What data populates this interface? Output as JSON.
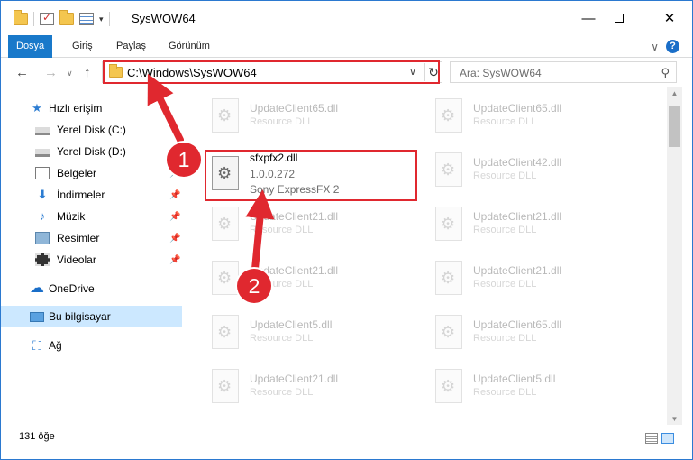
{
  "window": {
    "title": "SysWOW64",
    "controls": {
      "minimize": "—",
      "maximize": "",
      "close": "✕"
    }
  },
  "ribbon": {
    "tabs": [
      "Dosya",
      "Giriş",
      "Paylaş",
      "Görünüm"
    ],
    "help": "?",
    "chevron": "∨"
  },
  "nav": {
    "back": "←",
    "forward": "→",
    "recent": "∨",
    "up": "↑",
    "address": "C:\\Windows\\SysWOW64",
    "address_dropdown": "∨",
    "refresh": "↻",
    "search_placeholder": "Ara: SysWOW64",
    "search_icon": "⚲"
  },
  "sidebar": {
    "items": [
      {
        "label": "Hızlı erişim",
        "icon": "star-icon",
        "glyph": "★",
        "pinned": false
      },
      {
        "label": "Yerel Disk (C:)",
        "icon": "disk-icon",
        "glyph": "",
        "pinned": false
      },
      {
        "label": "Yerel Disk (D:)",
        "icon": "disk-icon",
        "glyph": "",
        "pinned": false
      },
      {
        "label": "Belgeler",
        "icon": "documents-icon",
        "glyph": "",
        "pinned": true
      },
      {
        "label": "İndirmeler",
        "icon": "downloads-icon",
        "glyph": "⬇",
        "pinned": true
      },
      {
        "label": "Müzik",
        "icon": "music-icon",
        "glyph": "♪",
        "pinned": true
      },
      {
        "label": "Resimler",
        "icon": "pictures-icon",
        "glyph": "",
        "pinned": true
      },
      {
        "label": "Videolar",
        "icon": "videos-icon",
        "glyph": "",
        "pinned": true
      },
      {
        "label": "OneDrive",
        "icon": "cloud-icon",
        "glyph": "☁",
        "pinned": false
      },
      {
        "label": "Bu bilgisayar",
        "icon": "computer-icon",
        "glyph": "",
        "pinned": false
      },
      {
        "label": "Ağ",
        "icon": "network-icon",
        "glyph": "⛶",
        "pinned": false
      }
    ],
    "pin_glyph": "📌"
  },
  "files": {
    "background": [
      {
        "name": "UpdateClient65.dll",
        "desc": "Resource DLL"
      },
      {
        "name": "UpdateClient65.dll",
        "desc": "Resource DLL"
      },
      {
        "name": "UpdateClient42.dll",
        "desc": "Resource DLL"
      },
      {
        "name": "UpdateClient21.dll",
        "desc": "Resource DLL"
      },
      {
        "name": "UpdateClient21.dll",
        "desc": "Resource DLL"
      },
      {
        "name": "UpdateClient21.dll",
        "desc": "Resource DLL"
      },
      {
        "name": "UpdateClient21.dll",
        "desc": "Resource DLL"
      },
      {
        "name": "UpdateClient5.dll",
        "desc": "Resource DLL"
      },
      {
        "name": "UpdateClient65.dll",
        "desc": "Resource DLL"
      },
      {
        "name": "UpdateClient21.dll",
        "desc": "Resource DLL"
      },
      {
        "name": "UpdateClient5.dll",
        "desc": "Resource DLL"
      }
    ],
    "highlighted": {
      "name": "sfxpfx2.dll",
      "version": "1.0.0.272",
      "company": "Sony ExpressFX 2"
    }
  },
  "status": {
    "count": "131 öğe"
  },
  "annotations": {
    "step1": "1",
    "step2": "2",
    "highlight_color": "#e0282f"
  },
  "colors": {
    "accent": "#1979ca",
    "selection": "#cce8ff"
  }
}
